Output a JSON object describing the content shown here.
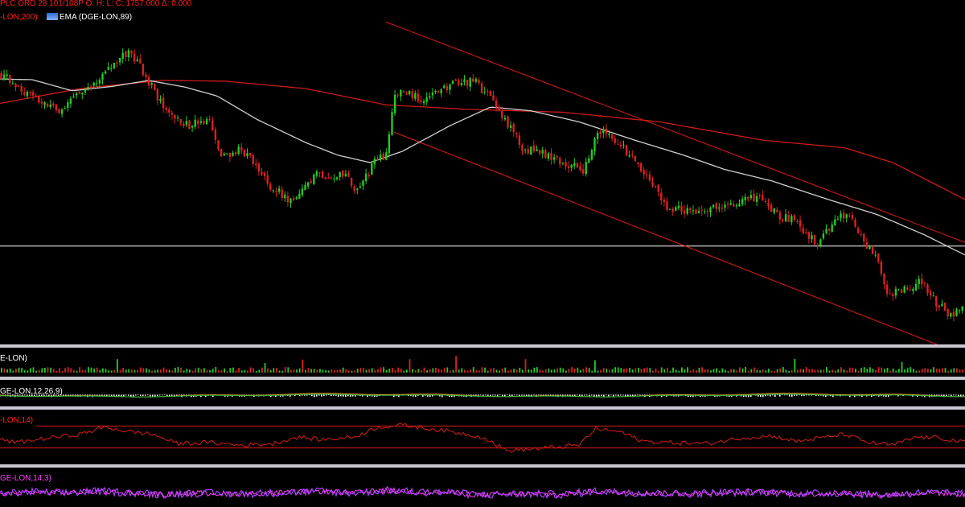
{
  "header": {
    "quote_line": "PLC ORD 28 101/108P   O:    H:    L:    C: 1757.000   Δ: 0.000",
    "sma_label": "-LON,200)",
    "ema_label": "EMA (DGE-LON,89)"
  },
  "panels": {
    "volume_label": "E-LON)",
    "macd_label": "GE-LON,12,26,9)",
    "rsi_label": "-LON,14)",
    "stoch_label": "GE-LON,14,3)"
  },
  "colors": {
    "background": "#000000",
    "up": "#22cc22",
    "down": "#dd2020",
    "sma": "#cc1a1a",
    "ema": "#d0d0d0",
    "channel": "#dd1a1a",
    "support": "#ffffff",
    "stoch": "#b040ff"
  },
  "icons": {
    "ema": "ema-chart-icon"
  },
  "chart_data": [
    {
      "type": "candlestick",
      "series": [
        {
          "name": "-LON,200)",
          "kind": "sma"
        },
        {
          "name": "EMA (DGE-LON,89)",
          "kind": "ema"
        }
      ],
      "close_anchors": [
        [
          0,
          1790
        ],
        [
          40,
          1760
        ],
        [
          70,
          1740
        ],
        [
          100,
          1765
        ],
        [
          130,
          1790
        ],
        [
          160,
          1820
        ],
        [
          180,
          1790
        ],
        [
          200,
          1750
        ],
        [
          230,
          1720
        ],
        [
          260,
          1725
        ],
        [
          275,
          1675
        ],
        [
          300,
          1690
        ],
        [
          335,
          1640
        ],
        [
          365,
          1615
        ],
        [
          395,
          1655
        ],
        [
          430,
          1650
        ],
        [
          445,
          1630
        ],
        [
          465,
          1670
        ],
        [
          480,
          1680
        ],
        [
          490,
          1760
        ],
        [
          500,
          1765
        ],
        [
          530,
          1755
        ],
        [
          560,
          1775
        ],
        [
          590,
          1780
        ],
        [
          615,
          1750
        ],
        [
          630,
          1725
        ],
        [
          650,
          1690
        ],
        [
          680,
          1680
        ],
        [
          710,
          1665
        ],
        [
          725,
          1660
        ],
        [
          745,
          1715
        ],
        [
          765,
          1700
        ],
        [
          790,
          1670
        ],
        [
          810,
          1645
        ],
        [
          830,
          1610
        ],
        [
          860,
          1605
        ],
        [
          890,
          1610
        ],
        [
          920,
          1615
        ],
        [
          945,
          1625
        ],
        [
          965,
          1600
        ],
        [
          990,
          1590
        ],
        [
          1015,
          1560
        ],
        [
          1040,
          1595
        ],
        [
          1055,
          1600
        ],
        [
          1075,
          1560
        ],
        [
          1090,
          1545
        ],
        [
          1105,
          1490
        ],
        [
          1125,
          1500
        ],
        [
          1145,
          1510
        ],
        [
          1165,
          1480
        ],
        [
          1185,
          1460
        ],
        [
          1200,
          1485
        ]
      ],
      "sma_anchors": [
        [
          0,
          1750
        ],
        [
          100,
          1770
        ],
        [
          200,
          1781
        ],
        [
          280,
          1780
        ],
        [
          380,
          1770
        ],
        [
          480,
          1748
        ],
        [
          580,
          1742
        ],
        [
          700,
          1738
        ],
        [
          820,
          1725
        ],
        [
          950,
          1700
        ],
        [
          1050,
          1690
        ],
        [
          1110,
          1670
        ],
        [
          1200,
          1620
        ]
      ],
      "ema_anchors": [
        [
          0,
          1783
        ],
        [
          40,
          1782
        ],
        [
          90,
          1767
        ],
        [
          140,
          1773
        ],
        [
          185,
          1781
        ],
        [
          230,
          1772
        ],
        [
          270,
          1760
        ],
        [
          320,
          1728
        ],
        [
          380,
          1697
        ],
        [
          420,
          1680
        ],
        [
          460,
          1670
        ],
        [
          500,
          1685
        ],
        [
          560,
          1720
        ],
        [
          610,
          1745
        ],
        [
          660,
          1740
        ],
        [
          720,
          1725
        ],
        [
          790,
          1700
        ],
        [
          850,
          1680
        ],
        [
          900,
          1661
        ],
        [
          960,
          1645
        ],
        [
          1030,
          1620
        ],
        [
          1090,
          1600
        ],
        [
          1150,
          1572
        ],
        [
          1200,
          1545
        ]
      ],
      "channel_upper": [
        [
          480,
          1860
        ],
        [
          1200,
          1562
        ]
      ],
      "channel_lower": [
        [
          490,
          1711
        ],
        [
          1165,
          1424
        ]
      ],
      "support": 1557,
      "ylim": [
        1424,
        1868
      ]
    },
    {
      "type": "bar",
      "name": "volume",
      "series": [
        {
          "name": "E-LON)"
        }
      ]
    },
    {
      "type": "line",
      "name": "macd",
      "series": [
        {
          "name": "GE-LON,12,26,9)"
        }
      ]
    },
    {
      "type": "line",
      "name": "rsi",
      "series": [
        {
          "name": "-LON,14)"
        }
      ],
      "levels": [
        70,
        30
      ],
      "anchors": [
        [
          0,
          45
        ],
        [
          20,
          40
        ],
        [
          60,
          48
        ],
        [
          100,
          55
        ],
        [
          130,
          68
        ],
        [
          160,
          60
        ],
        [
          190,
          55
        ],
        [
          220,
          38
        ],
        [
          260,
          40
        ],
        [
          300,
          35
        ],
        [
          340,
          38
        ],
        [
          370,
          50
        ],
        [
          400,
          45
        ],
        [
          440,
          50
        ],
        [
          470,
          68
        ],
        [
          500,
          72
        ],
        [
          560,
          60
        ],
        [
          600,
          50
        ],
        [
          630,
          25
        ],
        [
          680,
          30
        ],
        [
          720,
          35
        ],
        [
          740,
          65
        ],
        [
          770,
          60
        ],
        [
          800,
          42
        ],
        [
          830,
          40
        ],
        [
          880,
          38
        ],
        [
          920,
          48
        ],
        [
          960,
          52
        ],
        [
          990,
          42
        ],
        [
          1020,
          48
        ],
        [
          1050,
          55
        ],
        [
          1080,
          40
        ],
        [
          1110,
          35
        ],
        [
          1140,
          50
        ],
        [
          1170,
          48
        ],
        [
          1200,
          40
        ]
      ]
    },
    {
      "type": "line",
      "name": "stochastic",
      "series": [
        {
          "name": "GE-LON,14,3)"
        }
      ],
      "anchors": [
        [
          0,
          45
        ],
        [
          40,
          52
        ],
        [
          80,
          48
        ],
        [
          120,
          55
        ],
        [
          160,
          50
        ],
        [
          200,
          42
        ],
        [
          240,
          48
        ],
        [
          300,
          45
        ],
        [
          360,
          50
        ],
        [
          400,
          55
        ],
        [
          440,
          48
        ],
        [
          480,
          58
        ],
        [
          520,
          52
        ],
        [
          560,
          50
        ],
        [
          600,
          40
        ],
        [
          650,
          45
        ],
        [
          700,
          42
        ],
        [
          740,
          55
        ],
        [
          800,
          48
        ],
        [
          850,
          45
        ],
        [
          900,
          50
        ],
        [
          950,
          52
        ],
        [
          1000,
          45
        ],
        [
          1050,
          48
        ],
        [
          1100,
          40
        ],
        [
          1150,
          50
        ],
        [
          1200,
          45
        ]
      ]
    }
  ]
}
